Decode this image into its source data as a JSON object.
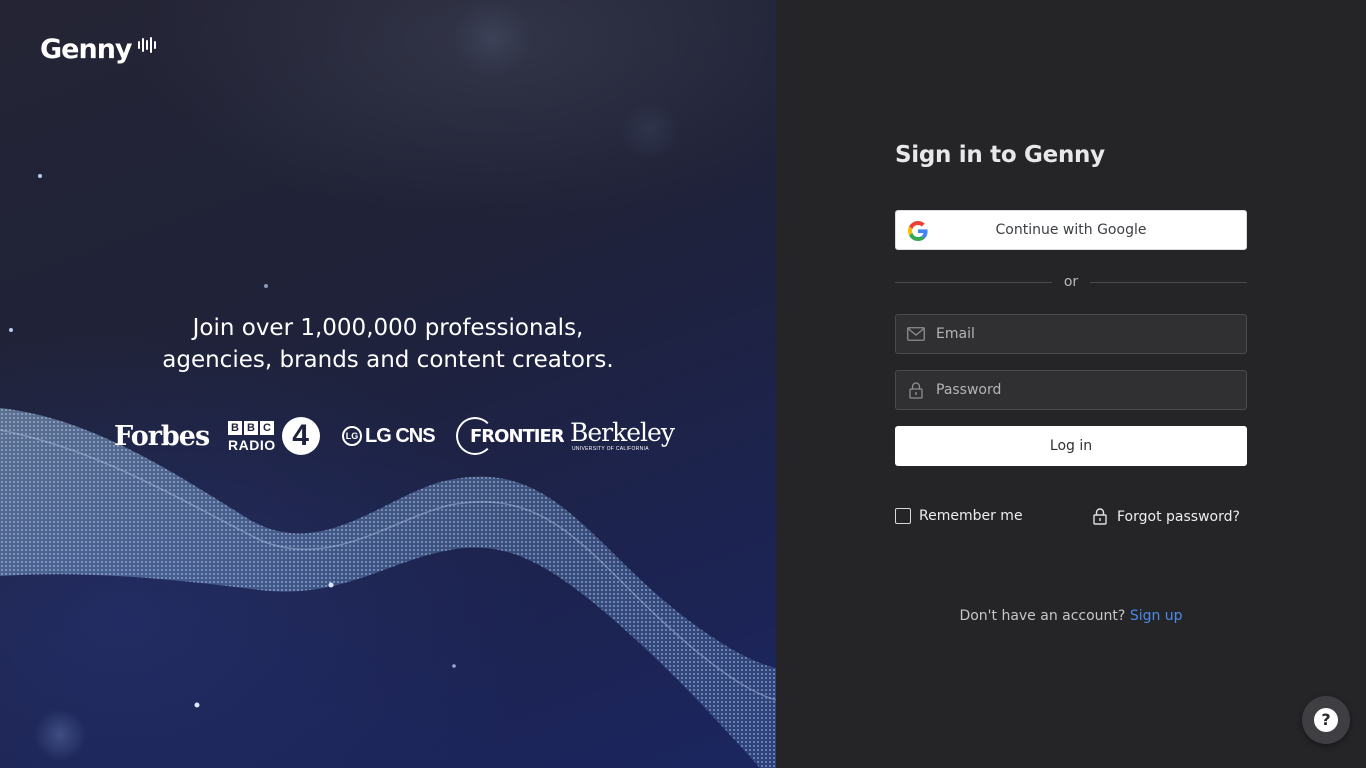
{
  "brand": {
    "logo_text": "Genny"
  },
  "hero": {
    "tagline_line1": "Join over 1,000,000 professionals,",
    "tagline_line2": "agencies, brands and content creators.",
    "brands": {
      "forbes": "Forbes",
      "bbc_letters": [
        "B",
        "B",
        "C"
      ],
      "bbc_radio": "RADIO",
      "bbc_number": "4",
      "lg_mark": "LG",
      "lg_text": "LG CNS",
      "frontier": "FRONTIER",
      "berkeley": "Berkeley",
      "berkeley_sub": "UNIVERSITY OF CALIFORNIA"
    }
  },
  "auth": {
    "title": "Sign in to Genny",
    "google_button": "Continue with Google",
    "divider_text": "or",
    "email_placeholder": "Email",
    "password_placeholder": "Password",
    "login_button": "Log in",
    "remember_me": "Remember me",
    "forgot_password": "Forgot password?",
    "no_account_text": "Don't have an account?",
    "signup_link": "Sign up"
  },
  "help": {
    "label": "?"
  },
  "icons": {
    "google": "google-g-icon",
    "email": "envelope-icon",
    "password": "lock-icon",
    "forgot": "lock-icon",
    "help": "question-icon"
  },
  "colors": {
    "panel_bg": "#252527",
    "link": "#4a8ae8",
    "button_bg": "#ffffff"
  }
}
